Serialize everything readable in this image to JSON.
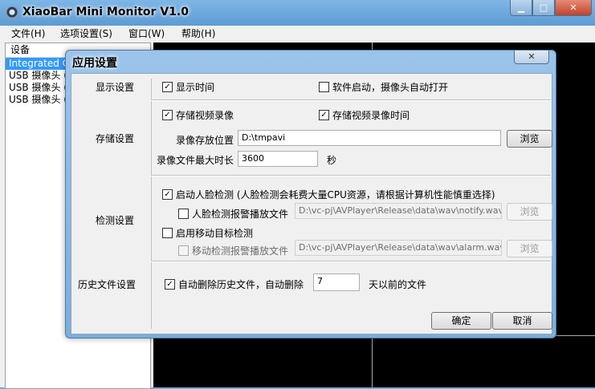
{
  "window": {
    "title": "XiaoBar Mini Monitor V1.0",
    "min_glyph": "▁",
    "max_glyph": "□",
    "close_glyph": "✕"
  },
  "menu": [
    "文件(H)",
    "选项设置(S)",
    "窗口(W)",
    "帮助(H)"
  ],
  "device_list": {
    "header": "设备",
    "items": [
      "Integrated C",
      "USB 摄像头 (",
      "USB 摄像头 (",
      "USB 摄像头 ("
    ],
    "selected_index": 0
  },
  "dialog": {
    "title": "应用设置",
    "close_glyph": "✕",
    "check_glyph": "✓",
    "display": {
      "label": "显示设置",
      "show_time": {
        "label": "显示时间",
        "checked": true
      },
      "auto_open": {
        "label": "软件启动，摄像头自动打开",
        "checked": false
      }
    },
    "storage": {
      "label": "存储设置",
      "store_video": {
        "label": "存储视频录像",
        "checked": true
      },
      "store_time": {
        "label": "存储视频录像时间",
        "checked": true
      },
      "path_label": "录像存放位置",
      "path_value": "D:\\tmpavi",
      "browse": "浏览",
      "max_len_label": "录像文件最大时长",
      "max_len_value": "3600",
      "unit": "秒"
    },
    "detect": {
      "label": "检测设置",
      "face": {
        "label": "启动人脸检测 (人脸检测会耗费大量CPU资源，请根据计算机性能慎重选择)",
        "checked": true
      },
      "face_alarm": {
        "label": "人脸检测报警播放文件",
        "checked": false,
        "path": "D:\\vc-pj\\AVPlayer\\Release\\data\\wav\\notify.wav",
        "browse": "浏览"
      },
      "motion": {
        "label": "启用移动目标检测",
        "checked": false
      },
      "motion_alarm": {
        "label": "移动检测报警播放文件",
        "checked": false,
        "path": "D:\\vc-pj\\AVPlayer\\Release\\data\\wav\\alarm.wav",
        "browse": "浏览"
      }
    },
    "history": {
      "label": "历史文件设置",
      "auto_delete": {
        "label": "自动删除历史文件，自动删除",
        "checked": true
      },
      "days": "7",
      "days_suffix": "天以前的文件"
    },
    "ok": "确定",
    "cancel": "取消"
  }
}
